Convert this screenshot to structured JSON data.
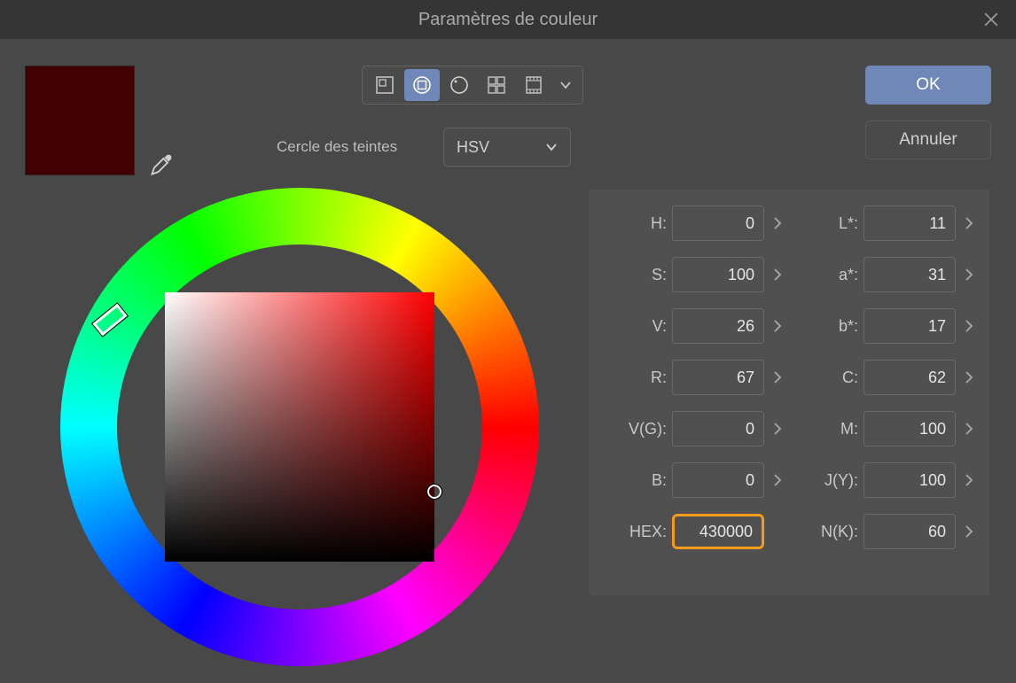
{
  "title": "Paramètres de couleur",
  "swatch_color": "#430000",
  "toolbar": {
    "tint_ring_label": "Cercle des teintes",
    "model": "HSV"
  },
  "buttons": {
    "ok": "OK",
    "cancel": "Annuler"
  },
  "values": {
    "H": "0",
    "S": "100",
    "V": "26",
    "R": "67",
    "VG": "0",
    "B": "0",
    "HEX": "430000",
    "Lstar": "11",
    "astar": "31",
    "bstar": "17",
    "C": "62",
    "M": "100",
    "JY": "100",
    "NK": "60"
  },
  "labels": {
    "H": "H:",
    "S": "S:",
    "V": "V:",
    "R": "R:",
    "VG": "V(G):",
    "B": "B:",
    "HEX": "HEX:",
    "Lstar": "L*:",
    "astar": "a*:",
    "bstar": "b*:",
    "C": "C:",
    "M": "M:",
    "JY": "J(Y):",
    "NK": "N(K):"
  }
}
